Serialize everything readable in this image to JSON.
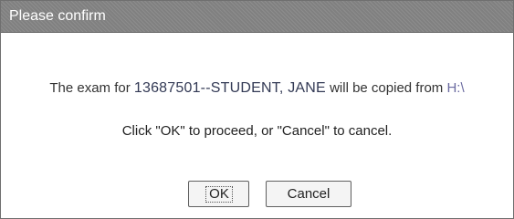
{
  "dialog": {
    "title": "Please confirm",
    "message": {
      "prefix": "The exam for ",
      "student": "13687501--STUDENT, JANE",
      "middle": " will be copied from ",
      "path": "H:\\"
    },
    "instruction": "Click \"OK\" to proceed, or \"Cancel\" to cancel.",
    "buttons": {
      "ok_label": "OK",
      "cancel_label": "Cancel"
    }
  },
  "colors": {
    "titlebar": "#808080",
    "title_text": "#ffffff",
    "student_text": "#333a55",
    "path_text": "#6a6aa0"
  }
}
